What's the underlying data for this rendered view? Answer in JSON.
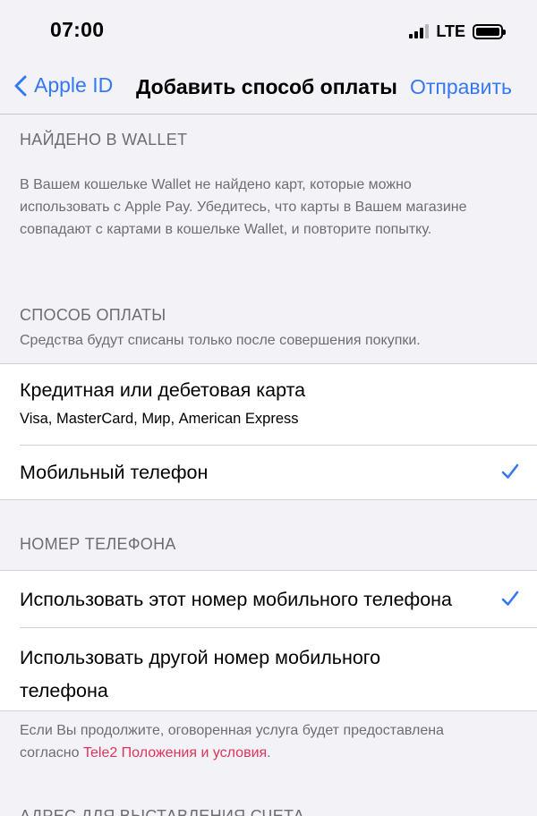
{
  "status_bar": {
    "time": "07:00",
    "network": "LTE"
  },
  "nav": {
    "back_label": "Apple ID",
    "title": "Добавить способ оплаты",
    "action_label": "Отправить"
  },
  "wallet_section": {
    "header": "НАЙДЕНО В WALLET",
    "message_lines": [
      "В Вашем кошельке Wallet не найдено карт, которые можно",
      "использовать с Apple Pay. Убедитесь, что карты в Вашем магазине",
      "совпадают с картами в кошельке Wallet, и повторите попытку."
    ]
  },
  "payment_section": {
    "header": "СПОСОБ ОПЛАТЫ",
    "subheader": "Средства будут списаны только после совершения покупки.",
    "options": [
      {
        "title": "Кредитная или дебетовая карта",
        "subtitle": "Visa, MasterCard, Мир, American Express",
        "selected": false
      },
      {
        "title": "Мобильный телефон",
        "selected": true
      }
    ]
  },
  "phone_section": {
    "header": "НОМЕР ТЕЛЕФОНА",
    "options": [
      {
        "title": "Использовать этот номер мобильного телефона",
        "selected": true
      },
      {
        "title_line1": "Использовать другой номер мобильного",
        "title_line2": "телефона",
        "selected": false
      }
    ],
    "footer_line1": "Если Вы продолжите, оговоренная услуга будет предоставлена",
    "footer_prefix": "согласно ",
    "footer_link": "Tele2 Положения и условия",
    "footer_suffix": "."
  },
  "billing_section": {
    "header": "АДРЕС ДЛЯ ВЫСТАВЛЕНИЯ СЧЕТА"
  },
  "colors": {
    "accent": "#3478f6",
    "link": "#e0345a",
    "background": "#f2f2f7",
    "secondary_text": "#6d6d72"
  },
  "icons": {
    "back": "chevron-left-icon",
    "check": "checkmark-icon"
  }
}
